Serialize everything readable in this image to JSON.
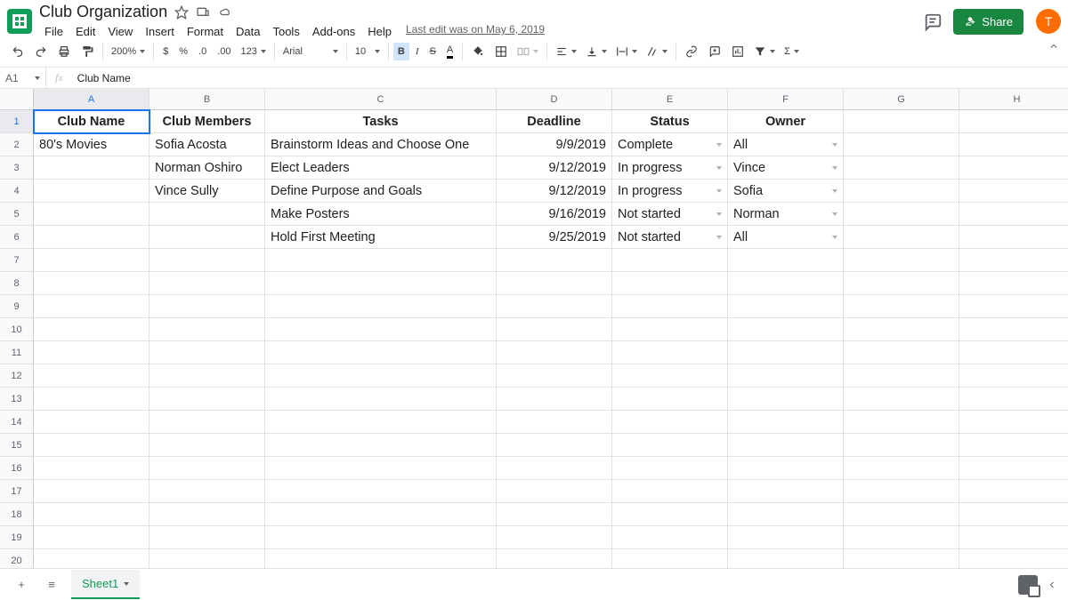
{
  "doc": {
    "title": "Club Organization",
    "last_edit": "Last edit was on May 6, 2019"
  },
  "menu": [
    "File",
    "Edit",
    "View",
    "Insert",
    "Format",
    "Data",
    "Tools",
    "Add-ons",
    "Help"
  ],
  "toolbar": {
    "zoom": "200%",
    "font": "Arial",
    "size": "10"
  },
  "share": {
    "label": "Share"
  },
  "avatar": {
    "initial": "T"
  },
  "name_box": "A1",
  "formula": "Club Name",
  "columns": [
    "A",
    "B",
    "C",
    "D",
    "E",
    "F",
    "G",
    "H"
  ],
  "row_count": 21,
  "headers": [
    "Club Name",
    "Club Members",
    "Tasks",
    "Deadline",
    "Status",
    "Owner"
  ],
  "rows": [
    {
      "a": "80's Movies",
      "b": "Sofia Acosta",
      "c": "Brainstorm Ideas and Choose One",
      "d": "9/9/2019",
      "e": "Complete",
      "f": "All"
    },
    {
      "a": "",
      "b": "Norman Oshiro",
      "c": "Elect Leaders",
      "d": "9/12/2019",
      "e": "In progress",
      "f": "Vince"
    },
    {
      "a": "",
      "b": "Vince Sully",
      "c": "Define Purpose and Goals",
      "d": "9/12/2019",
      "e": "In progress",
      "f": "Sofia"
    },
    {
      "a": "",
      "b": "",
      "c": "Make Posters",
      "d": "9/16/2019",
      "e": "Not started",
      "f": "Norman"
    },
    {
      "a": "",
      "b": "",
      "c": "Hold First Meeting",
      "d": "9/25/2019",
      "e": "Not started",
      "f": "All"
    }
  ],
  "sheet_tab": "Sheet1",
  "chart_data": {
    "type": "table",
    "columns": [
      "Club Name",
      "Club Members",
      "Tasks",
      "Deadline",
      "Status",
      "Owner"
    ],
    "rows": [
      [
        "80's Movies",
        "Sofia Acosta",
        "Brainstorm Ideas and Choose One",
        "9/9/2019",
        "Complete",
        "All"
      ],
      [
        "",
        "Norman Oshiro",
        "Elect Leaders",
        "9/12/2019",
        "In progress",
        "Vince"
      ],
      [
        "",
        "Vince Sully",
        "Define Purpose and Goals",
        "9/12/2019",
        "In progress",
        "Sofia"
      ],
      [
        "",
        "",
        "Make Posters",
        "9/16/2019",
        "Not started",
        "Norman"
      ],
      [
        "",
        "",
        "Hold First Meeting",
        "9/25/2019",
        "Not started",
        "All"
      ]
    ]
  }
}
